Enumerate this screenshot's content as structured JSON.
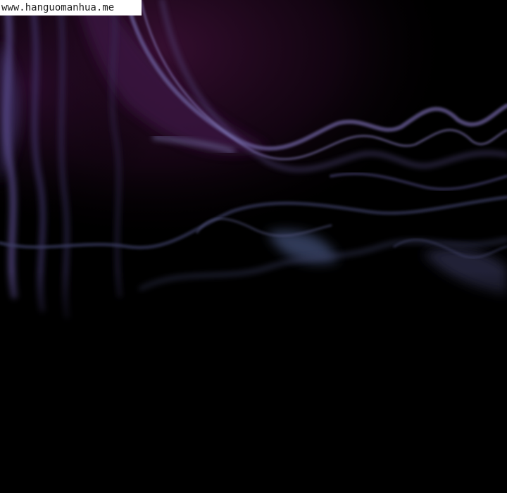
{
  "watermark": {
    "text": "www.hanguomanhua.me"
  },
  "colors": {
    "background": "#000000",
    "purple_shadow": "#2a0a2a",
    "magenta_glow": "#3a0f34",
    "lavender_streak": "#6a5f9a",
    "blue_haze": "#3c4a6e",
    "watermark_bg": "#ffffff",
    "watermark_text": "#222222"
  }
}
